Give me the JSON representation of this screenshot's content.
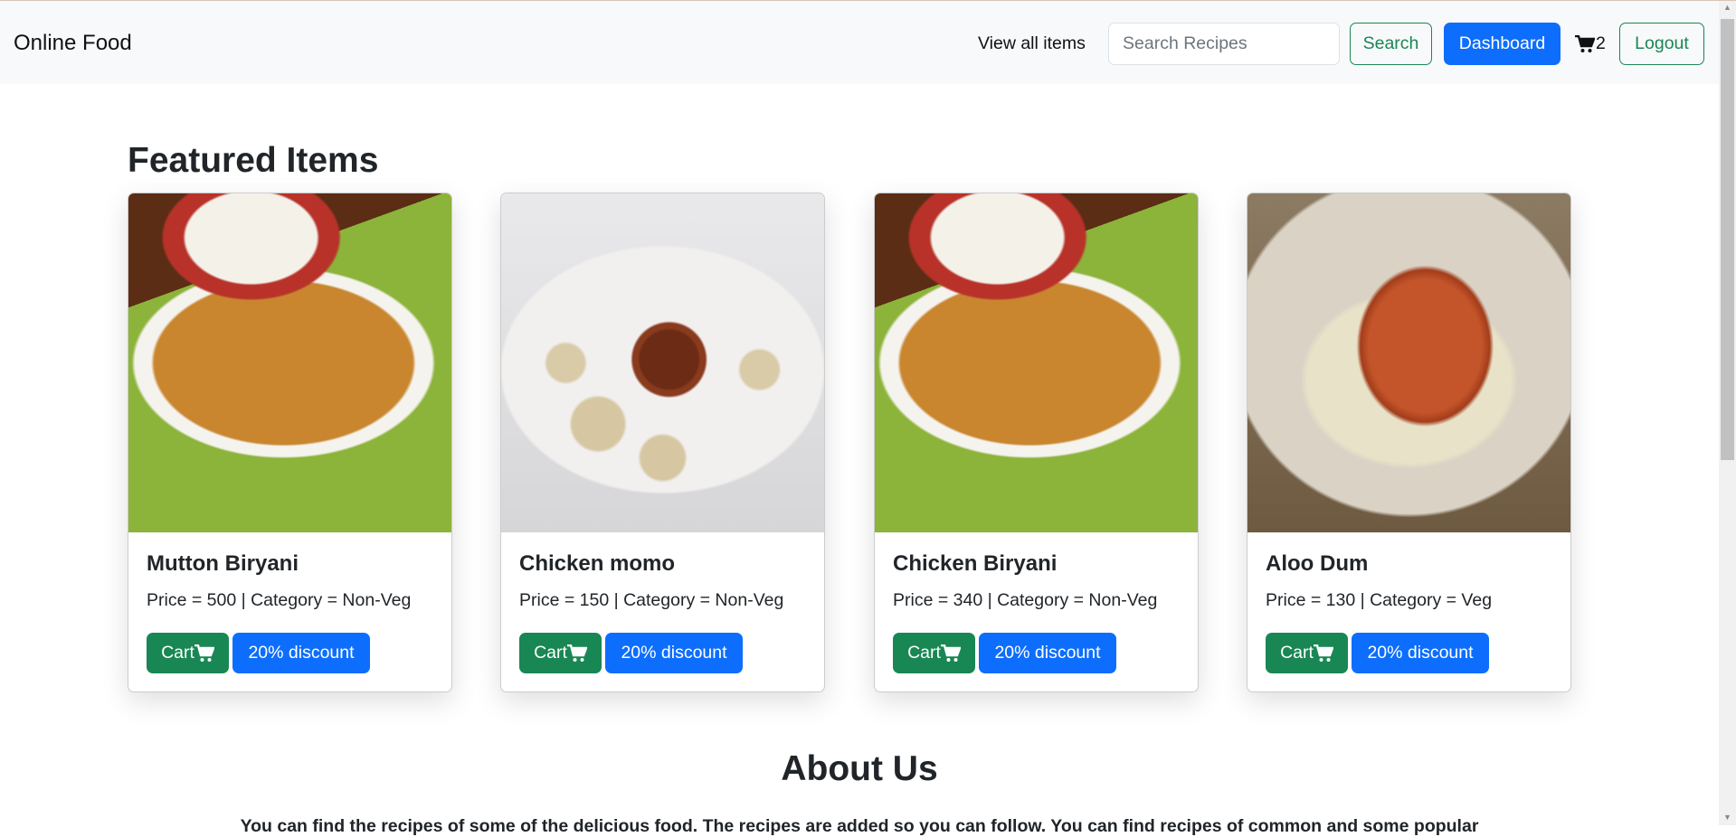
{
  "navbar": {
    "brand": "Online Food",
    "view_all": "View all items",
    "search_placeholder": "Search Recipes",
    "search_label": "Search",
    "dashboard_label": "Dashboard",
    "cart_count": "2",
    "logout_label": "Logout"
  },
  "featured": {
    "heading": "Featured Items",
    "items": [
      {
        "name": "Mutton Biryani",
        "details": "Price = 500 | Category = Non-Veg",
        "cart": "Cart",
        "discount": "20% discount"
      },
      {
        "name": "Chicken momo",
        "details": "Price = 150 | Category = Non-Veg",
        "cart": "Cart",
        "discount": "20% discount"
      },
      {
        "name": "Chicken Biryani",
        "details": "Price = 340 | Category = Non-Veg",
        "cart": "Cart",
        "discount": "20% discount"
      },
      {
        "name": "Aloo Dum",
        "details": "Price = 130 | Category = Veg",
        "cart": "Cart",
        "discount": "20% discount"
      }
    ]
  },
  "about": {
    "heading": "About Us",
    "text": "You can find the recipes of some of the delicious food. The recipes are added so you can follow. You can find recipes of common and some popular"
  }
}
